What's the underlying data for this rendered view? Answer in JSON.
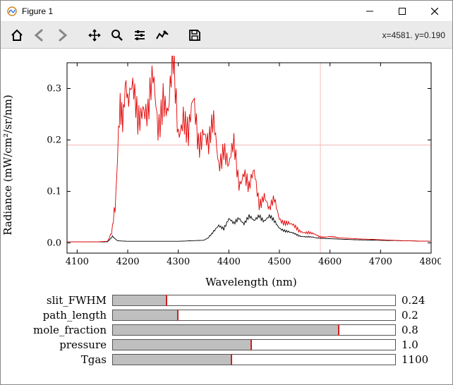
{
  "window": {
    "title": "Figure 1"
  },
  "toolbar": {
    "cursor_readout": "x=4581. y=0.190"
  },
  "chart_data": {
    "type": "line",
    "title": "",
    "xlabel": "Wavelength (nm)",
    "ylabel": "Radiance (mW/cm²/sr/nm)",
    "xlim": [
      4080,
      4800
    ],
    "ylim": [
      -0.02,
      0.35
    ],
    "xticks": [
      4100,
      4200,
      4300,
      4400,
      4500,
      4600,
      4700,
      4800
    ],
    "yticks": [
      0.0,
      0.1,
      0.2,
      0.3
    ],
    "crosshair": {
      "x": 4581,
      "y": 0.19
    },
    "series": [
      {
        "name": "black",
        "color": "#000000",
        "x": [
          4080,
          4120,
          4160,
          4170,
          4180,
          4200,
          4250,
          4300,
          4350,
          4360,
          4370,
          4380,
          4390,
          4400,
          4410,
          4420,
          4430,
          4440,
          4450,
          4460,
          4470,
          4480,
          4500,
          4520,
          4540,
          4560,
          4580,
          4600,
          4650,
          4700,
          4750,
          4800
        ],
        "y": [
          0.002,
          0.002,
          0.002,
          0.012,
          0.004,
          0.003,
          0.003,
          0.003,
          0.005,
          0.01,
          0.02,
          0.035,
          0.03,
          0.045,
          0.035,
          0.05,
          0.04,
          0.05,
          0.04,
          0.055,
          0.045,
          0.05,
          0.03,
          0.02,
          0.014,
          0.011,
          0.009,
          0.008,
          0.006,
          0.005,
          0.004,
          0.003
        ]
      },
      {
        "name": "red",
        "color": "#e20000",
        "x": [
          4080,
          4140,
          4160,
          4170,
          4175,
          4180,
          4185,
          4190,
          4195,
          4200,
          4210,
          4220,
          4230,
          4240,
          4250,
          4260,
          4270,
          4280,
          4290,
          4300,
          4310,
          4320,
          4330,
          4340,
          4350,
          4360,
          4370,
          4380,
          4390,
          4400,
          4410,
          4420,
          4430,
          4440,
          4450,
          4460,
          4470,
          4480,
          4490,
          4500,
          4520,
          4540,
          4560,
          4580,
          4600,
          4650,
          4700,
          4750,
          4800
        ],
        "y": [
          0.002,
          0.002,
          0.003,
          0.02,
          0.08,
          0.18,
          0.24,
          0.27,
          0.29,
          0.26,
          0.28,
          0.25,
          0.29,
          0.24,
          0.3,
          0.23,
          0.31,
          0.24,
          0.33,
          0.22,
          0.27,
          0.2,
          0.26,
          0.2,
          0.24,
          0.18,
          0.22,
          0.16,
          0.2,
          0.14,
          0.18,
          0.12,
          0.15,
          0.1,
          0.13,
          0.08,
          0.1,
          0.06,
          0.08,
          0.05,
          0.035,
          0.025,
          0.018,
          0.013,
          0.011,
          0.008,
          0.006,
          0.004,
          0.003
        ]
      }
    ]
  },
  "sliders": [
    {
      "name": "slit_FWHM",
      "label": "slit_FWHM",
      "value_text": "0.24",
      "fill": 0.19,
      "mark": 0.19
    },
    {
      "name": "path_length",
      "label": "path_length",
      "value_text": "0.2",
      "fill": 0.23,
      "mark": 0.23
    },
    {
      "name": "mole_fraction",
      "label": "mole_fraction",
      "value_text": "0.8",
      "fill": 0.8,
      "mark": 0.8
    },
    {
      "name": "pressure",
      "label": "pressure",
      "value_text": "1.0",
      "fill": 0.49,
      "mark": 0.49
    },
    {
      "name": "Tgas",
      "label": "Tgas",
      "value_text": "1100",
      "fill": 0.42,
      "mark": 0.42
    }
  ]
}
